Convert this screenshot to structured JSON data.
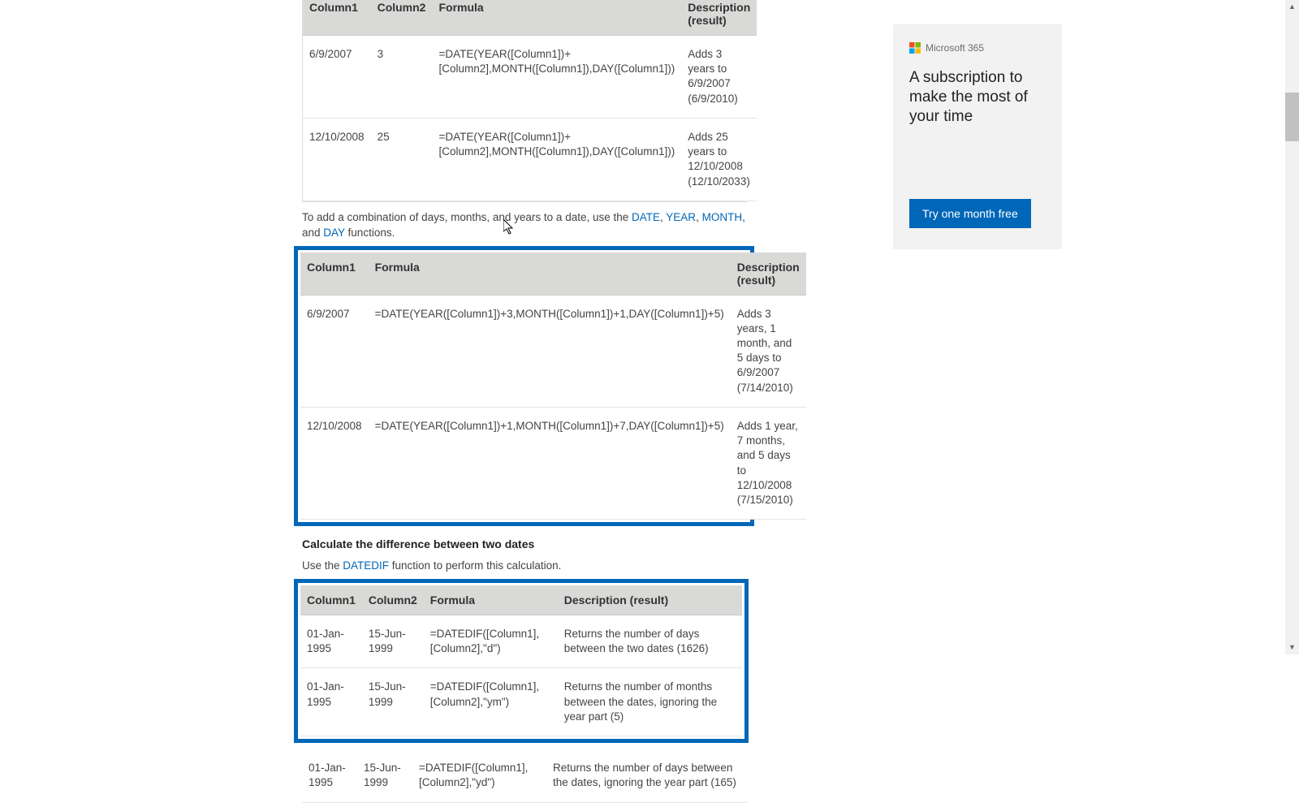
{
  "table1": {
    "headers": {
      "c1": "Column1",
      "c2": "Column2",
      "c3": "Formula",
      "c4": "Description (result)"
    },
    "rows": [
      {
        "c1": "6/9/2007",
        "c2": "3",
        "c3": "=DATE(YEAR([Column1])+[Column2],MONTH([Column1]),DAY([Column1]))",
        "c4": "Adds 3 years to 6/9/2007 (6/9/2010)"
      },
      {
        "c1": "12/10/2008",
        "c2": "25",
        "c3": "=DATE(YEAR([Column1])+[Column2],MONTH([Column1]),DAY([Column1]))",
        "c4": "Adds 25 years to 12/10/2008 (12/10/2033)"
      }
    ]
  },
  "intro2_before": "To add a combination of days, months, and years to a date, use the ",
  "intro2_links": {
    "date": "DATE",
    "year": "YEAR",
    "month": "MONTH",
    "day": "DAY"
  },
  "intro2_sep1": ", ",
  "intro2_sep_and": ", and ",
  "intro2_after": " functions.",
  "table2": {
    "headers": {
      "c1": "Column1",
      "c2": "Formula",
      "c3": "Description (result)"
    },
    "rows": [
      {
        "c1": "6/9/2007",
        "c2": "=DATE(YEAR([Column1])+3,MONTH([Column1])+1,DAY([Column1])+5)",
        "c3": "Adds 3 years, 1 month, and 5 days to 6/9/2007 (7/14/2010)"
      },
      {
        "c1": "12/10/2008",
        "c2": "=DATE(YEAR([Column1])+1,MONTH([Column1])+7,DAY([Column1])+5)",
        "c3": "Adds 1 year, 7 months, and 5 days to 12/10/2008 (7/15/2010)"
      }
    ]
  },
  "section3_title": "Calculate the difference between two dates",
  "intro3_before": "Use the ",
  "intro3_link": "DATEDIF",
  "intro3_after": " function to perform this calculation.",
  "table3": {
    "headers": {
      "c1": "Column1",
      "c2": "Column2",
      "c3": "Formula",
      "c4": "Description (result)"
    },
    "rows": [
      {
        "c1": "01-Jan-1995",
        "c2": "15-Jun-1999",
        "c3": "=DATEDIF([Column1], [Column2],\"d\")",
        "c4": "Returns the number of days between the two dates (1626)"
      },
      {
        "c1": "01-Jan-1995",
        "c2": "15-Jun-1999",
        "c3": "=DATEDIF([Column1], [Column2],\"ym\")",
        "c4": "Returns the number of months between the dates, ignoring the year part (5)"
      },
      {
        "c1": "01-Jan-1995",
        "c2": "15-Jun-1999",
        "c3": "=DATEDIF([Column1], [Column2],\"yd\")",
        "c4": "Returns the number of days between the dates, ignoring the year part (165)"
      }
    ]
  },
  "ad": {
    "logo_text": "Microsoft 365",
    "headline": "A subscription to make the most of your time",
    "button": "Try one month free"
  }
}
